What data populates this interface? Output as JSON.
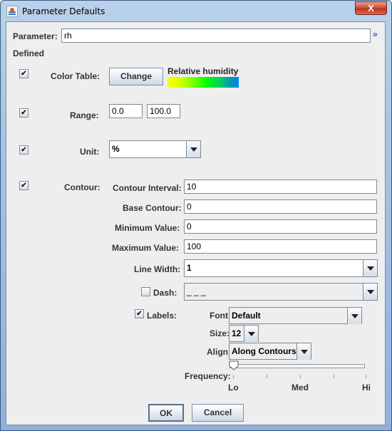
{
  "window": {
    "title": "Parameter Defaults",
    "close_label": "X"
  },
  "parameter": {
    "label": "Parameter:",
    "value": "rh"
  },
  "defined_label": "Defined",
  "color_table": {
    "checked": true,
    "label": "Color Table:",
    "button_label": "Change",
    "name": "Relative humidity"
  },
  "range": {
    "checked": true,
    "label": "Range:",
    "min": "0.0",
    "max": "100.0"
  },
  "unit": {
    "checked": true,
    "label": "Unit:",
    "value": "%"
  },
  "contour": {
    "checked": true,
    "label": "Contour:",
    "interval_label": "Contour Interval:",
    "interval": "10",
    "base_label": "Base Contour:",
    "base": "0",
    "min_label": "Minimum Value:",
    "min": "0",
    "max_label": "Maximum Value:",
    "max": "100",
    "line_width_label": "Line Width:",
    "line_width": "1",
    "dash_checked": false,
    "dash_label": "Dash:",
    "dash": "_ _ _",
    "labels_checked": true,
    "labels_label": "Labels:",
    "font_label": "Font:",
    "font": "Default",
    "size_label": "Size:",
    "size": "12",
    "align_label": "Align:",
    "align": "Along Contours",
    "frequency_label": "Frequency:",
    "frequency_value": 0.0,
    "frequency_ticks": [
      "Lo",
      "Med",
      "Hi"
    ]
  },
  "buttons": {
    "ok": "OK",
    "cancel": "Cancel"
  },
  "check_glyph": "✔"
}
